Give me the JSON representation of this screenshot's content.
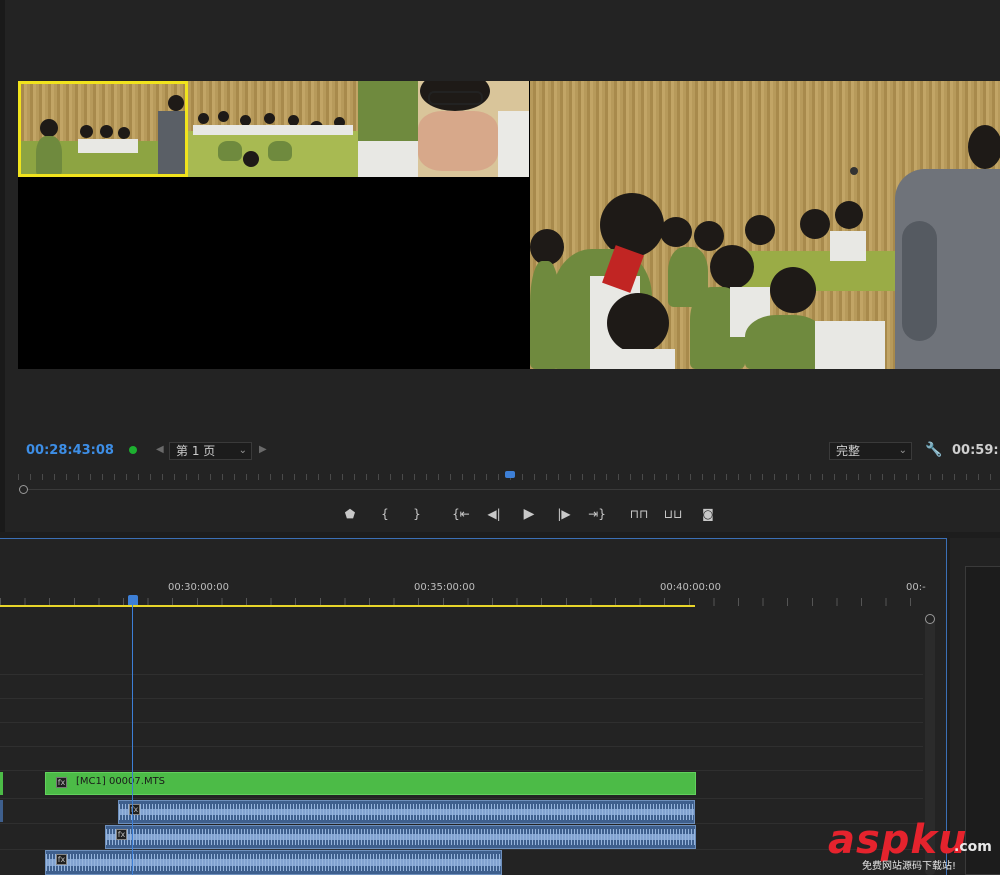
{
  "monitor": {
    "current_timecode": "00:28:43:08",
    "page_select": {
      "value": "第 1 页"
    },
    "quality_select": {
      "value": "完整"
    },
    "duration_timecode": "00:59:1"
  },
  "timeline": {
    "ruler_labels": [
      "00:30:00:00",
      "00:35:00:00",
      "00:40:00:00",
      "00:-"
    ],
    "video_clip": {
      "name": "[MC1] 00007.MTS",
      "fx": "fx",
      "color": "#4cbb47"
    },
    "audio_fx": "fx"
  },
  "colors": {
    "timecode_blue": "#3d8ee6",
    "selected_angle": "#f1e31d",
    "work_area": "#e8d52a",
    "playhead": "#3d7fd6"
  },
  "icons": {
    "transport": [
      "marker-icon",
      "mark-in-icon",
      "mark-out-icon",
      "go-to-in-icon",
      "step-back-icon",
      "play-icon",
      "step-forward-icon",
      "go-to-out-icon",
      "lift-icon",
      "extract-icon",
      "camera-icon"
    ]
  },
  "watermark": {
    "brand": "aspku",
    "tld": ".com",
    "tagline": "免费网站源码下载站!"
  }
}
